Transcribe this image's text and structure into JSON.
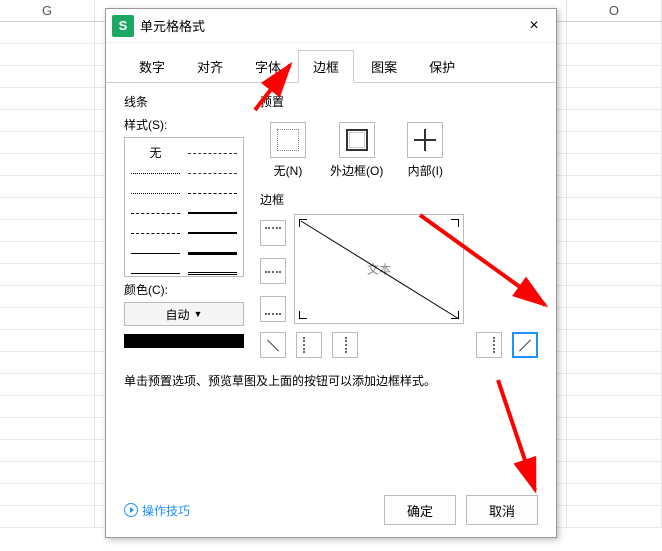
{
  "spreadsheet": {
    "col_left": "G",
    "col_right": "O"
  },
  "titlebar": {
    "app_icon_letter": "S",
    "title": "单元格格式",
    "close": "×"
  },
  "tabs": {
    "items": [
      "数字",
      "对齐",
      "字体",
      "边框",
      "图案",
      "保护"
    ],
    "active_index": 3
  },
  "sections": {
    "line_label": "线条",
    "preset_label": "预置",
    "style_label": "样式(S):",
    "style_none": "无",
    "color_label": "颜色(C):",
    "color_value": "自动",
    "border_label": "边框",
    "preview_text": "文本"
  },
  "presets": {
    "none": "无(N)",
    "outline": "外边框(O)",
    "inside": "内部(I)"
  },
  "hint": "单击预置选项、预览草图及上面的按钮可以添加边框样式。",
  "footer": {
    "tips": "操作技巧",
    "ok": "确定",
    "cancel": "取消"
  }
}
